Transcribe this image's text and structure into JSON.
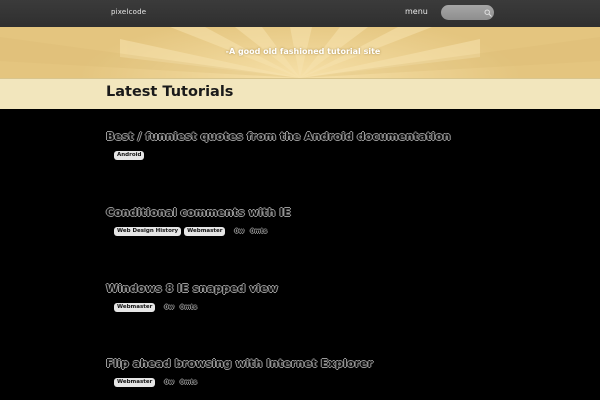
{
  "header": {
    "logo_text": "pixelcode",
    "menu_label": "menu",
    "search_placeholder": "",
    "search_icon": "search-icon"
  },
  "hero": {
    "tagline": "-A good old fashioned tutorial site"
  },
  "section": {
    "title": "Latest Tutorials"
  },
  "posts": [
    {
      "title": "Best / funniest quotes from the Android documentation",
      "tags": [
        "Android"
      ],
      "meta": []
    },
    {
      "title": "Conditional comments with IE",
      "tags": [
        "Web Design History",
        "Webmaster"
      ],
      "meta": [
        "0w",
        "0mts"
      ]
    },
    {
      "title": "Windows 8 IE snapped view",
      "tags": [
        "Webmaster"
      ],
      "meta": [
        "0w",
        "0mts"
      ]
    },
    {
      "title": "Flip ahead browsing with Internet Explorer",
      "tags": [
        "Webmaster"
      ],
      "meta": [
        "0w",
        "0mts"
      ]
    }
  ],
  "colors": {
    "topbar": "#333333",
    "hero": "#ecd191",
    "titlebar": "#f2e6bd",
    "background": "#000000"
  }
}
